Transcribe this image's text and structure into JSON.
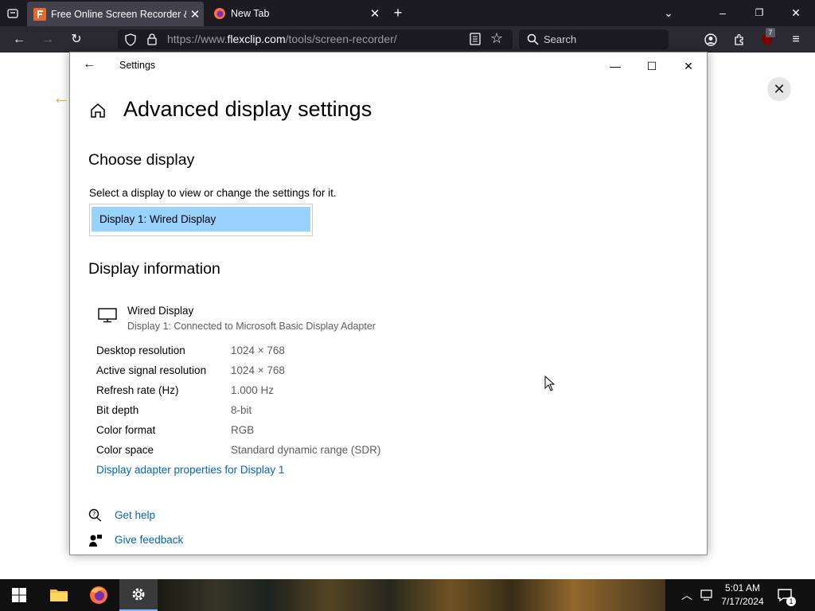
{
  "browser": {
    "tabs": [
      {
        "title": "Free Online Screen Recorder & l",
        "active": true
      },
      {
        "title": "New Tab",
        "active": false
      }
    ],
    "url_prefix": "https://www.",
    "url_domain": "flexclip.com",
    "url_path": "/tools/screen-recorder/",
    "search_placeholder": "Search",
    "badge_count": "7"
  },
  "settings": {
    "window_title": "Settings",
    "page_title": "Advanced display settings",
    "choose_display_heading": "Choose display",
    "choose_display_desc": "Select a display to view or change the settings for it.",
    "selected_display": "Display 1: Wired Display",
    "display_info_heading": "Display information",
    "display_name": "Wired Display",
    "display_subtitle": "Display 1: Connected to Microsoft Basic Display Adapter",
    "info_rows": [
      {
        "label": "Desktop resolution",
        "value": "1024 × 768"
      },
      {
        "label": "Active signal resolution",
        "value": "1024 × 768"
      },
      {
        "label": "Refresh rate (Hz)",
        "value": "1.000 Hz"
      },
      {
        "label": "Bit depth",
        "value": "8-bit"
      },
      {
        "label": "Color format",
        "value": "RGB"
      },
      {
        "label": "Color space",
        "value": "Standard dynamic range (SDR)"
      }
    ],
    "adapter_link": "Display adapter properties for Display 1",
    "get_help": "Get help",
    "give_feedback": "Give feedback"
  },
  "taskbar": {
    "time": "5:01 AM",
    "date": "7/17/2024",
    "notification_count": "1"
  },
  "colors": {
    "link": "#0067b8",
    "selected_option": "#99d1ff",
    "browser_tabbar": "#1c1b22",
    "browser_toolbar": "#2b2a33",
    "page_accent": "#e8a33c"
  }
}
